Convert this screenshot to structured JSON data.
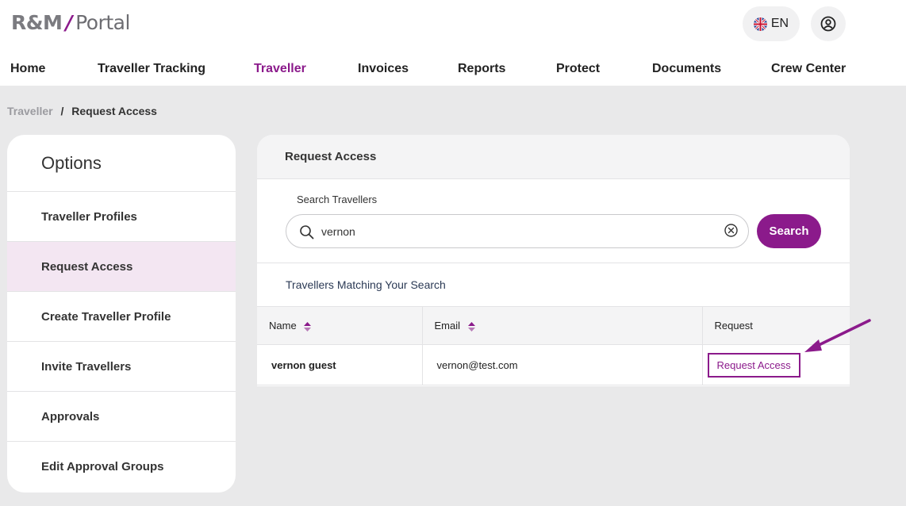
{
  "header": {
    "logo_brand": "R&M",
    "logo_slash": "/",
    "logo_product": "Portal",
    "language": "EN"
  },
  "nav": {
    "items": [
      {
        "label": "Home"
      },
      {
        "label": "Traveller Tracking"
      },
      {
        "label": "Traveller"
      },
      {
        "label": "Invoices"
      },
      {
        "label": "Reports"
      },
      {
        "label": "Protect"
      },
      {
        "label": "Documents"
      },
      {
        "label": "Crew Center"
      }
    ],
    "active": "Traveller"
  },
  "breadcrumb": {
    "parent": "Traveller",
    "separator": "/",
    "current": "Request Access"
  },
  "sidebar": {
    "title": "Options",
    "items": [
      {
        "label": "Traveller Profiles"
      },
      {
        "label": "Request Access"
      },
      {
        "label": "Create Traveller Profile"
      },
      {
        "label": "Invite Travellers"
      },
      {
        "label": "Approvals"
      },
      {
        "label": "Edit Approval Groups"
      }
    ],
    "active": "Request Access"
  },
  "panel": {
    "title": "Request Access",
    "search": {
      "label": "Search Travellers",
      "value": "vernon",
      "button_label": "Search"
    },
    "results_title": "Travellers Matching Your Search",
    "table": {
      "columns": [
        "Name",
        "Email",
        "Request"
      ],
      "rows": [
        {
          "name": "vernon guest",
          "email": "vernon@test.com",
          "action": "Request Access"
        }
      ]
    }
  },
  "colors": {
    "brand_purple": "#8b1a8b",
    "active_sidebar_bg": "#f3e6f2",
    "page_bg": "#e9e9ea"
  },
  "icons": [
    "uk-flag-icon",
    "user-circle-icon",
    "search-icon",
    "clear-circle-x-icon",
    "sort-icon",
    "annotation-arrow"
  ]
}
